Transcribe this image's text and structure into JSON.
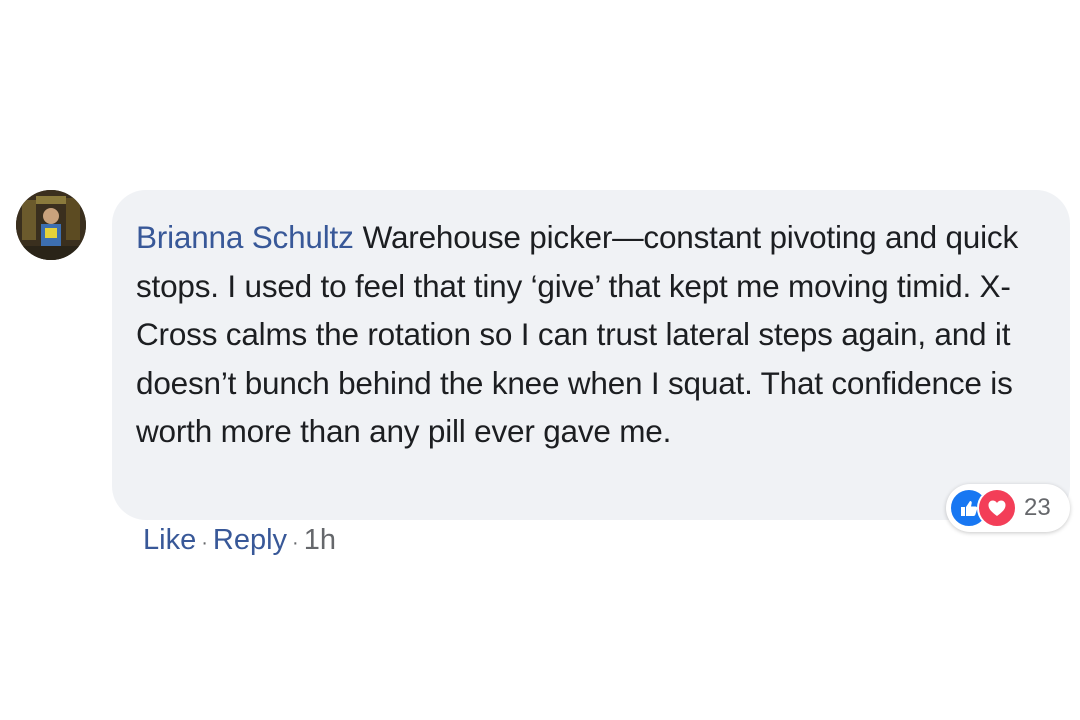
{
  "comment": {
    "author": "Brianna Schultz",
    "text": "Warehouse picker—constant pivoting and quick stops. I used to feel that tiny ‘give’ that kept me moving timid. X-Cross calms the rotation so I can trust lateral steps again, and it doesn’t bunch behind the knee when I squat. That confidence is worth more than any pill ever gave me.",
    "reactions": {
      "icons": [
        "like-icon",
        "love-icon"
      ],
      "count": "23"
    },
    "actions": {
      "like_label": "Like",
      "reply_label": "Reply",
      "separator": "·",
      "timestamp": "1h"
    }
  },
  "colors": {
    "bubble_bg": "#f0f2f5",
    "author_name": "#385898",
    "link": "#385898",
    "like_blue": "#1877f2",
    "love_red": "#f33e58",
    "muted": "#65676b"
  }
}
